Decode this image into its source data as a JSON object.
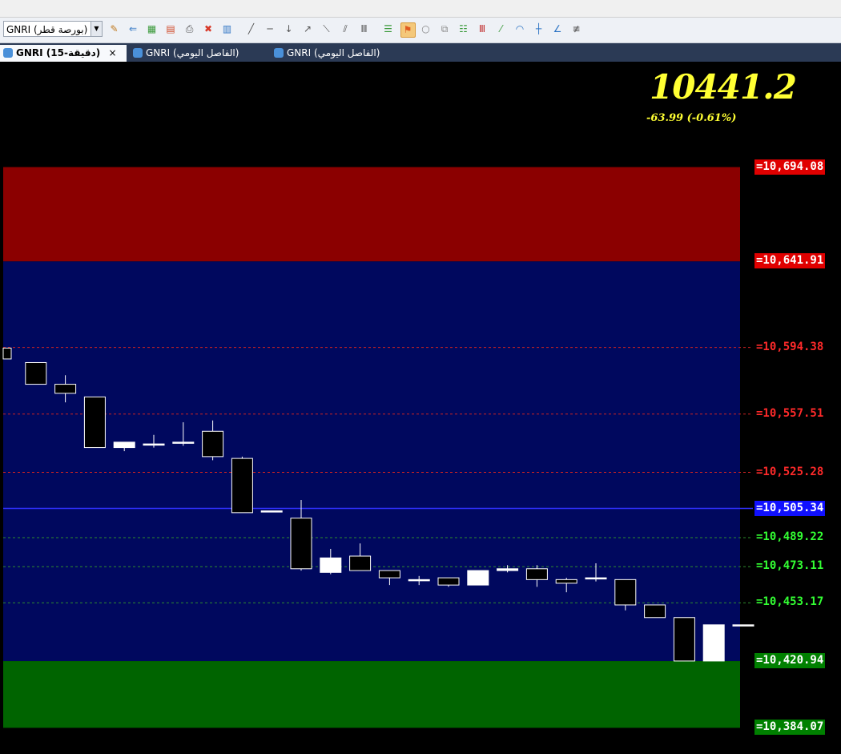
{
  "toolbar": {
    "symbol_value": "GNRI (بورصة قطر)",
    "icons": [
      "wand-icon",
      "import-icon",
      "add-chart-icon",
      "remove-chart-icon",
      "print-icon",
      "delete-icon",
      "indicator-icon",
      "line-draw-icon",
      "horizontal-line-icon",
      "vertical-line-icon",
      "ray-icon",
      "channel-icon",
      "parallel-icon",
      "bars-icon",
      "level-icon",
      "magnet-icon",
      "circle-icon",
      "copy-icon",
      "grid-icon",
      "fan-icon",
      "gann-icon",
      "arc-icon",
      "fib-icon",
      "angle-icon",
      "pitchfork-icon"
    ]
  },
  "tabs": [
    {
      "label": "GNRI (15-دقيقة)",
      "active": true
    },
    {
      "label": "GNRI (الفاصل اليومي)",
      "active": false
    },
    {
      "label": "GNRI (الفاصل اليومي)",
      "active": false
    }
  ],
  "close_glyph": "×",
  "quote": {
    "last": "10441.2",
    "change": "-63.99  (-0.61%)"
  },
  "colors": {
    "upper_zone": "#8b0000",
    "main_zone": "#00085e",
    "lower_zone": "#006400",
    "resistance": "#ff2a2a",
    "support": "#33ff33",
    "pivot": "#1010ff"
  },
  "chart_data": {
    "type": "candlestick",
    "title": "",
    "ylim": [
      10378,
      10720
    ],
    "zones": [
      {
        "name": "upper",
        "from": 10641.91,
        "to": 10694.08,
        "color": "#8b0000"
      },
      {
        "name": "main",
        "from": 10420.94,
        "to": 10641.91,
        "color": "#00085e"
      },
      {
        "name": "lower",
        "from": 10384.07,
        "to": 10420.94,
        "color": "#006400"
      }
    ],
    "levels": [
      {
        "label": "=10,694.08",
        "value": 10694.08,
        "kind": "res-box",
        "line": false
      },
      {
        "label": "=10,641.91",
        "value": 10641.91,
        "kind": "res-box",
        "line": false
      },
      {
        "label": "=10,594.38",
        "value": 10594.38,
        "kind": "res",
        "line": true
      },
      {
        "label": "=10,557.51",
        "value": 10557.51,
        "kind": "res",
        "line": true
      },
      {
        "label": "=10,525.28",
        "value": 10525.28,
        "kind": "res",
        "line": true
      },
      {
        "label": "=10,505.34",
        "value": 10505.34,
        "kind": "pivot",
        "line": true
      },
      {
        "label": "=10,489.22",
        "value": 10489.22,
        "kind": "sup",
        "line": true
      },
      {
        "label": "=10,473.11",
        "value": 10473.11,
        "kind": "sup",
        "line": true
      },
      {
        "label": "=10,453.17",
        "value": 10453.17,
        "kind": "sup",
        "line": true
      },
      {
        "label": "=10,420.94",
        "value": 10420.94,
        "kind": "sup-box",
        "line": false
      },
      {
        "label": "=10,384.07",
        "value": 10384.07,
        "kind": "sup-box",
        "line": false
      }
    ],
    "candles": [
      {
        "o": 10594,
        "h": 10594,
        "l": 10588,
        "c": 10588
      },
      {
        "o": 10586,
        "h": 10586,
        "l": 10574,
        "c": 10574
      },
      {
        "o": 10574,
        "h": 10579,
        "l": 10564,
        "c": 10569
      },
      {
        "o": 10567,
        "h": 10567,
        "l": 10539,
        "c": 10539
      },
      {
        "o": 10539,
        "h": 10542,
        "l": 10537,
        "c": 10542
      },
      {
        "o": 10541,
        "h": 10546,
        "l": 10539,
        "c": 10541
      },
      {
        "o": 10542,
        "h": 10553,
        "l": 10540,
        "c": 10542
      },
      {
        "o": 10548,
        "h": 10554,
        "l": 10532,
        "c": 10534
      },
      {
        "o": 10533,
        "h": 10534,
        "l": 10503,
        "c": 10503
      },
      {
        "o": 10504,
        "h": 10504,
        "l": 10504,
        "c": 10504
      },
      {
        "o": 10500,
        "h": 10510,
        "l": 10471,
        "c": 10472
      },
      {
        "o": 10470,
        "h": 10483,
        "l": 10469,
        "c": 10478
      },
      {
        "o": 10479,
        "h": 10486,
        "l": 10471,
        "c": 10471
      },
      {
        "o": 10471,
        "h": 10471,
        "l": 10463,
        "c": 10467
      },
      {
        "o": 10466,
        "h": 10468,
        "l": 10463,
        "c": 10466
      },
      {
        "o": 10467,
        "h": 10467,
        "l": 10462,
        "c": 10463
      },
      {
        "o": 10463,
        "h": 10471,
        "l": 10463,
        "c": 10471
      },
      {
        "o": 10471,
        "h": 10474,
        "l": 10470,
        "c": 10472
      },
      {
        "o": 10472,
        "h": 10474,
        "l": 10462,
        "c": 10466
      },
      {
        "o": 10466,
        "h": 10467,
        "l": 10459,
        "c": 10464
      },
      {
        "o": 10467,
        "h": 10475,
        "l": 10465,
        "c": 10467
      },
      {
        "o": 10466,
        "h": 10466,
        "l": 10449,
        "c": 10452
      },
      {
        "o": 10452,
        "h": 10452,
        "l": 10445,
        "c": 10445
      },
      {
        "o": 10445,
        "h": 10445,
        "l": 10421,
        "c": 10421
      },
      {
        "o": 10421,
        "h": 10441,
        "l": 10421,
        "c": 10441
      },
      {
        "o": 10441,
        "h": 10441,
        "l": 10441,
        "c": 10441
      }
    ]
  }
}
